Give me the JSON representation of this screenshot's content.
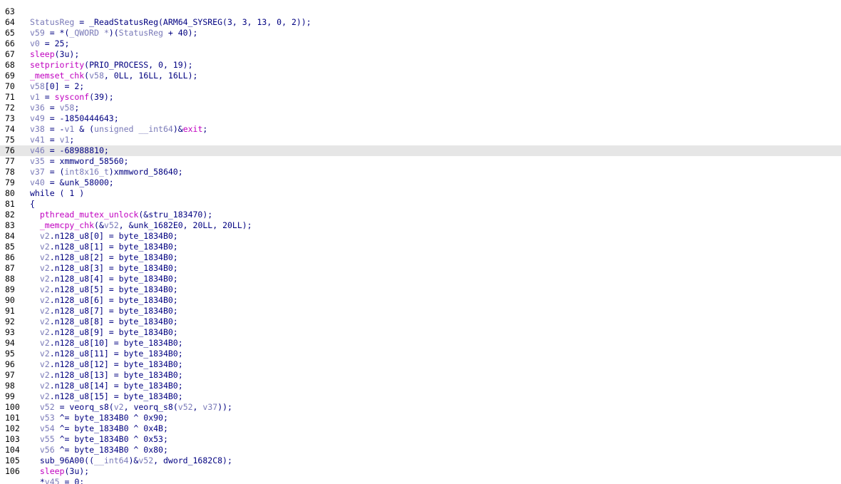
{
  "editor": {
    "highlighted_line": "76",
    "lines": [
      {
        "num": "",
        "tokens": [
          {
            "t": "__       ); [ ]       [ ]",
            "c": "k"
          }
        ]
      },
      {
        "num": "63",
        "tokens": []
      },
      {
        "num": "64",
        "tokens": [
          {
            "t": "StatusReg",
            "c": "v"
          },
          {
            "t": " = _ReadStatusReg(ARM64_SYSREG(3, 3, 13, 0, 2));",
            "c": "k"
          }
        ]
      },
      {
        "num": "65",
        "tokens": [
          {
            "t": "v59",
            "c": "v"
          },
          {
            "t": " = *(",
            "c": "k"
          },
          {
            "t": "_QWORD *",
            "c": "c"
          },
          {
            "t": ")(",
            "c": "k"
          },
          {
            "t": "StatusReg",
            "c": "v"
          },
          {
            "t": " + 40);",
            "c": "k"
          }
        ]
      },
      {
        "num": "66",
        "tokens": [
          {
            "t": "v0",
            "c": "v"
          },
          {
            "t": " = 25;",
            "c": "k"
          }
        ]
      },
      {
        "num": "67",
        "tokens": [
          {
            "t": "sleep",
            "c": "f"
          },
          {
            "t": "(3u);",
            "c": "k"
          }
        ]
      },
      {
        "num": "68",
        "tokens": [
          {
            "t": "setpriority",
            "c": "f"
          },
          {
            "t": "(PRIO_PROCESS, 0, 19);",
            "c": "k"
          }
        ]
      },
      {
        "num": "69",
        "tokens": [
          {
            "t": "_memset_chk",
            "c": "f"
          },
          {
            "t": "(",
            "c": "k"
          },
          {
            "t": "v58",
            "c": "v"
          },
          {
            "t": ", 0LL, 16LL, 16LL);",
            "c": "k"
          }
        ]
      },
      {
        "num": "70",
        "tokens": [
          {
            "t": "v58",
            "c": "v"
          },
          {
            "t": "[0] = 2;",
            "c": "k"
          }
        ]
      },
      {
        "num": "71",
        "tokens": [
          {
            "t": "v1",
            "c": "v"
          },
          {
            "t": " = ",
            "c": "k"
          },
          {
            "t": "sysconf",
            "c": "f"
          },
          {
            "t": "(39);",
            "c": "k"
          }
        ]
      },
      {
        "num": "72",
        "tokens": [
          {
            "t": "v36",
            "c": "v"
          },
          {
            "t": " = ",
            "c": "k"
          },
          {
            "t": "v58",
            "c": "v"
          },
          {
            "t": ";",
            "c": "k"
          }
        ]
      },
      {
        "num": "73",
        "tokens": [
          {
            "t": "v49",
            "c": "v"
          },
          {
            "t": " = -1850444643;",
            "c": "k"
          }
        ]
      },
      {
        "num": "74",
        "tokens": [
          {
            "t": "v38",
            "c": "v"
          },
          {
            "t": " = -",
            "c": "k"
          },
          {
            "t": "v1",
            "c": "v"
          },
          {
            "t": " & (",
            "c": "k"
          },
          {
            "t": "unsigned __int64",
            "c": "c"
          },
          {
            "t": ")&",
            "c": "k"
          },
          {
            "t": "exit",
            "c": "f"
          },
          {
            "t": ";",
            "c": "k"
          }
        ]
      },
      {
        "num": "75",
        "tokens": [
          {
            "t": "v41",
            "c": "v"
          },
          {
            "t": " = ",
            "c": "k"
          },
          {
            "t": "v1",
            "c": "v"
          },
          {
            "t": ";",
            "c": "k"
          }
        ]
      },
      {
        "num": "76",
        "tokens": [
          {
            "t": "v46",
            "c": "v"
          },
          {
            "t": " = -68988810;",
            "c": "k"
          }
        ]
      },
      {
        "num": "77",
        "tokens": [
          {
            "t": "v35",
            "c": "v"
          },
          {
            "t": " = xmmword_58560;",
            "c": "k"
          }
        ]
      },
      {
        "num": "78",
        "tokens": [
          {
            "t": "v37",
            "c": "v"
          },
          {
            "t": " = (",
            "c": "k"
          },
          {
            "t": "int8x16_t",
            "c": "c"
          },
          {
            "t": ")xmmword_58640;",
            "c": "k"
          }
        ]
      },
      {
        "num": "79",
        "tokens": [
          {
            "t": "v40",
            "c": "v"
          },
          {
            "t": " = &unk_58000;",
            "c": "k"
          }
        ]
      },
      {
        "num": "80",
        "tokens": [
          {
            "t": "while ( 1 )",
            "c": "k"
          }
        ]
      },
      {
        "num": "81",
        "tokens": [
          {
            "t": "{",
            "c": "k"
          }
        ]
      },
      {
        "num": "82",
        "tokens": [
          {
            "t": "  ",
            "c": "k"
          },
          {
            "t": "pthread_mutex_unlock",
            "c": "f"
          },
          {
            "t": "(&stru_183470);",
            "c": "k"
          }
        ]
      },
      {
        "num": "83",
        "tokens": [
          {
            "t": "  ",
            "c": "k"
          },
          {
            "t": "_memcpy_chk",
            "c": "f"
          },
          {
            "t": "(&",
            "c": "k"
          },
          {
            "t": "v52",
            "c": "v"
          },
          {
            "t": ", &unk_1682E0, 20LL, 20LL);",
            "c": "k"
          }
        ]
      },
      {
        "num": "84",
        "tokens": [
          {
            "t": "  ",
            "c": "k"
          },
          {
            "t": "v2",
            "c": "v"
          },
          {
            "t": ".n128_u8[0] = byte_1834B0;",
            "c": "k"
          }
        ]
      },
      {
        "num": "85",
        "tokens": [
          {
            "t": "  ",
            "c": "k"
          },
          {
            "t": "v2",
            "c": "v"
          },
          {
            "t": ".n128_u8[1] = byte_1834B0;",
            "c": "k"
          }
        ]
      },
      {
        "num": "86",
        "tokens": [
          {
            "t": "  ",
            "c": "k"
          },
          {
            "t": "v2",
            "c": "v"
          },
          {
            "t": ".n128_u8[2] = byte_1834B0;",
            "c": "k"
          }
        ]
      },
      {
        "num": "87",
        "tokens": [
          {
            "t": "  ",
            "c": "k"
          },
          {
            "t": "v2",
            "c": "v"
          },
          {
            "t": ".n128_u8[3] = byte_1834B0;",
            "c": "k"
          }
        ]
      },
      {
        "num": "88",
        "tokens": [
          {
            "t": "  ",
            "c": "k"
          },
          {
            "t": "v2",
            "c": "v"
          },
          {
            "t": ".n128_u8[4] = byte_1834B0;",
            "c": "k"
          }
        ]
      },
      {
        "num": "89",
        "tokens": [
          {
            "t": "  ",
            "c": "k"
          },
          {
            "t": "v2",
            "c": "v"
          },
          {
            "t": ".n128_u8[5] = byte_1834B0;",
            "c": "k"
          }
        ]
      },
      {
        "num": "90",
        "tokens": [
          {
            "t": "  ",
            "c": "k"
          },
          {
            "t": "v2",
            "c": "v"
          },
          {
            "t": ".n128_u8[6] = byte_1834B0;",
            "c": "k"
          }
        ]
      },
      {
        "num": "91",
        "tokens": [
          {
            "t": "  ",
            "c": "k"
          },
          {
            "t": "v2",
            "c": "v"
          },
          {
            "t": ".n128_u8[7] = byte_1834B0;",
            "c": "k"
          }
        ]
      },
      {
        "num": "92",
        "tokens": [
          {
            "t": "  ",
            "c": "k"
          },
          {
            "t": "v2",
            "c": "v"
          },
          {
            "t": ".n128_u8[8] = byte_1834B0;",
            "c": "k"
          }
        ]
      },
      {
        "num": "93",
        "tokens": [
          {
            "t": "  ",
            "c": "k"
          },
          {
            "t": "v2",
            "c": "v"
          },
          {
            "t": ".n128_u8[9] = byte_1834B0;",
            "c": "k"
          }
        ]
      },
      {
        "num": "94",
        "tokens": [
          {
            "t": "  ",
            "c": "k"
          },
          {
            "t": "v2",
            "c": "v"
          },
          {
            "t": ".n128_u8[10] = byte_1834B0;",
            "c": "k"
          }
        ]
      },
      {
        "num": "95",
        "tokens": [
          {
            "t": "  ",
            "c": "k"
          },
          {
            "t": "v2",
            "c": "v"
          },
          {
            "t": ".n128_u8[11] = byte_1834B0;",
            "c": "k"
          }
        ]
      },
      {
        "num": "96",
        "tokens": [
          {
            "t": "  ",
            "c": "k"
          },
          {
            "t": "v2",
            "c": "v"
          },
          {
            "t": ".n128_u8[12] = byte_1834B0;",
            "c": "k"
          }
        ]
      },
      {
        "num": "97",
        "tokens": [
          {
            "t": "  ",
            "c": "k"
          },
          {
            "t": "v2",
            "c": "v"
          },
          {
            "t": ".n128_u8[13] = byte_1834B0;",
            "c": "k"
          }
        ]
      },
      {
        "num": "98",
        "tokens": [
          {
            "t": "  ",
            "c": "k"
          },
          {
            "t": "v2",
            "c": "v"
          },
          {
            "t": ".n128_u8[14] = byte_1834B0;",
            "c": "k"
          }
        ]
      },
      {
        "num": "99",
        "tokens": [
          {
            "t": "  ",
            "c": "k"
          },
          {
            "t": "v2",
            "c": "v"
          },
          {
            "t": ".n128_u8[15] = byte_1834B0;",
            "c": "k"
          }
        ]
      },
      {
        "num": "100",
        "tokens": [
          {
            "t": "  ",
            "c": "k"
          },
          {
            "t": "v52",
            "c": "v"
          },
          {
            "t": " = veorq_s8(",
            "c": "k"
          },
          {
            "t": "v2",
            "c": "v"
          },
          {
            "t": ", veorq_s8(",
            "c": "k"
          },
          {
            "t": "v52",
            "c": "v"
          },
          {
            "t": ", ",
            "c": "k"
          },
          {
            "t": "v37",
            "c": "v"
          },
          {
            "t": "));",
            "c": "k"
          }
        ]
      },
      {
        "num": "101",
        "tokens": [
          {
            "t": "  ",
            "c": "k"
          },
          {
            "t": "v53",
            "c": "v"
          },
          {
            "t": " ^= byte_1834B0 ^ 0x90;",
            "c": "k"
          }
        ]
      },
      {
        "num": "102",
        "tokens": [
          {
            "t": "  ",
            "c": "k"
          },
          {
            "t": "v54",
            "c": "v"
          },
          {
            "t": " ^= byte_1834B0 ^ 0x4B;",
            "c": "k"
          }
        ]
      },
      {
        "num": "103",
        "tokens": [
          {
            "t": "  ",
            "c": "k"
          },
          {
            "t": "v55",
            "c": "v"
          },
          {
            "t": " ^= byte_1834B0 ^ 0x53;",
            "c": "k"
          }
        ]
      },
      {
        "num": "104",
        "tokens": [
          {
            "t": "  ",
            "c": "k"
          },
          {
            "t": "v56",
            "c": "v"
          },
          {
            "t": " ^= byte_1834B0 ^ 0x80;",
            "c": "k"
          }
        ]
      },
      {
        "num": "105",
        "tokens": [
          {
            "t": "  sub_96A00((",
            "c": "k"
          },
          {
            "t": "__int64",
            "c": "c"
          },
          {
            "t": ")&",
            "c": "k"
          },
          {
            "t": "v52",
            "c": "v"
          },
          {
            "t": ", dword_1682C8);",
            "c": "k"
          }
        ]
      },
      {
        "num": "106",
        "tokens": [
          {
            "t": "  ",
            "c": "k"
          },
          {
            "t": "sleep",
            "c": "f"
          },
          {
            "t": "(3u);",
            "c": "k"
          }
        ]
      },
      {
        "num": "",
        "tokens": [
          {
            "t": "  *",
            "c": "k"
          },
          {
            "t": "v45",
            "c": "v"
          },
          {
            "t": " = 0;",
            "c": "k"
          }
        ]
      }
    ]
  }
}
